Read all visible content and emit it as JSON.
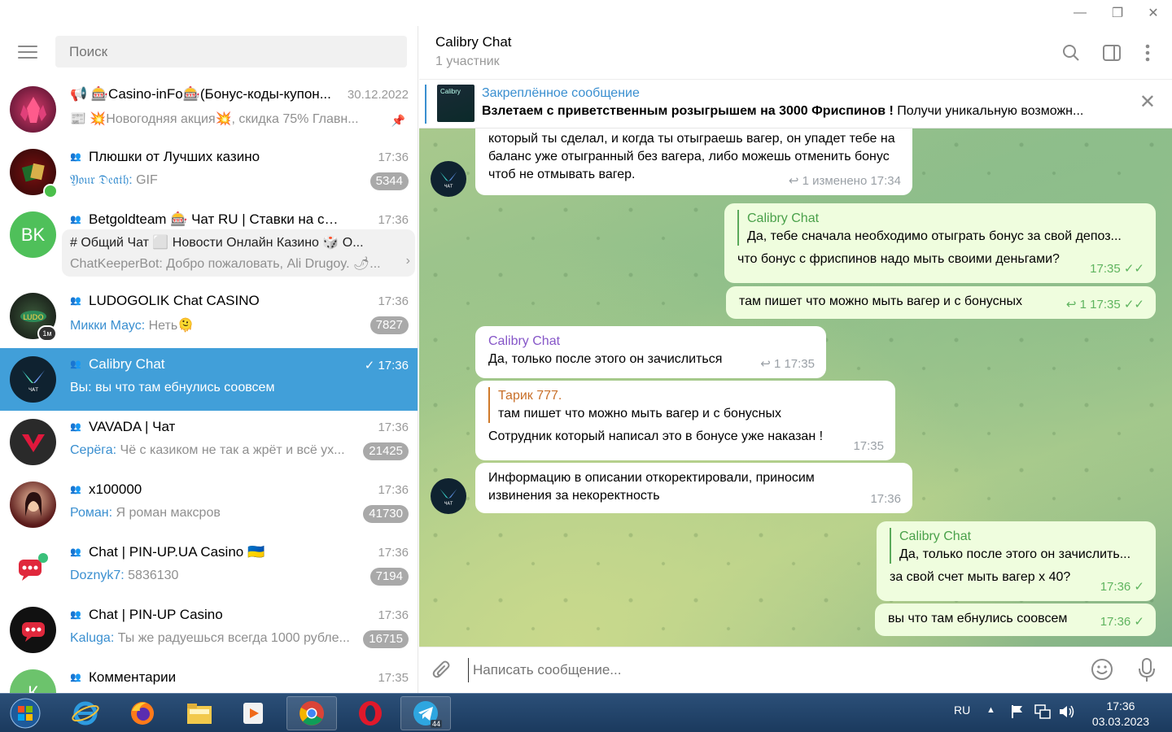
{
  "window": {
    "minimize": "—",
    "restore": "❐",
    "close": "✕"
  },
  "search": {
    "placeholder": "Поиск"
  },
  "chats": [
    {
      "title": "📢 🎰Casino-inFo🎰(Бонус-коды-купон...",
      "time": "30.12.2022",
      "preview": "📰 💥Новогодняя акция💥, скидка 75% Главн...",
      "pinned": true
    },
    {
      "title": "Плюшки от Лучших казино",
      "time": "17:36",
      "sender": "𝔜𝔬𝔲𝔯 𝔇𝔢𝔞𝔱𝔥:",
      "preview": " GIF",
      "badge": "5344"
    },
    {
      "title": "Betgoldteam 🎰 Чат RU | Ставки на спор...",
      "time": "17:36",
      "avatar_text": "BK",
      "topics": "# Общий Чат   ⬜ Новости Онлайн Казино   🎲 О...",
      "topic_sender": "ChatKeeperBot:",
      "topic_preview": " Добро пожаловать, Ali Drugoy. 🌶..."
    },
    {
      "title": "LUDOGOLIK Chat CASINO",
      "time": "17:36",
      "sender": "Микки Маус:",
      "preview": " Неть🫠",
      "badge": "7827"
    },
    {
      "title": "Calibry Chat",
      "time": "✓ 17:36",
      "preview": "Вы: вы что там ебнулись соовсем"
    },
    {
      "title": "VAVADA | Чат",
      "time": "17:36",
      "sender": "Серёга:",
      "preview": " Чё с казиком не так а жрёт и всё ух...",
      "badge": "21425"
    },
    {
      "title": "x100000",
      "time": "17:36",
      "sender": "Роман:",
      "preview": " Я роман максров",
      "badge": "41730"
    },
    {
      "title": "Chat | PIN-UP.UA Casino 🇺🇦",
      "time": "17:36",
      "sender": "Doznyk7:",
      "preview": " 5836130",
      "badge": "7194"
    },
    {
      "title": "Chat | PIN-UP Casino",
      "time": "17:36",
      "sender": "Kaluga:",
      "preview": " Ты же радуешься всегда 1000 рубле...",
      "badge": "16715"
    },
    {
      "title": "Комментарии",
      "time": "17:35",
      "avatar_text": "К"
    }
  ],
  "header": {
    "title": "Calibry Chat",
    "subtitle": "1 участник"
  },
  "pinned": {
    "label": "Закреплённое сообщение",
    "bold": "Взлетаем с приветственным розыгрышем на 3000 Фриспинов !",
    "text": " Получи уникальную возможн...",
    "thumb_text": "Calibry"
  },
  "messages": {
    "m1": {
      "text": "Да, тебе сначала необходимо отыграть бонус за свой депозит который ты сделал, и когда ты отыграешь вагер, он упадет тебе на баланс уже отыгранный без вагера, либо можешь отменить бонус чтоб не отмывать вагер.",
      "meta": "↩ 1   изменено 17:34"
    },
    "m2": {
      "reply_name": "Calibry Chat",
      "reply_text": "Да, тебе сначала необходимо отыграть бонус за свой депоз...",
      "text": "что бонус с фриспинов надо мыть своими деньгами?",
      "meta": "17:35 ✓✓"
    },
    "m3": {
      "text": "там пишет что можно мыть вагер и с бонусных",
      "meta": "↩ 1  17:35 ✓✓"
    },
    "m4": {
      "sender": "Calibry Chat",
      "text": "Да, только после этого он зачислиться",
      "meta": "↩ 1  17:35"
    },
    "m5": {
      "reply_name": "Тарик 777.",
      "reply_text": "там пишет что можно мыть вагер и с бонусных",
      "text": "Сотрудник который написал это в бонусе уже наказан !",
      "meta": "17:35"
    },
    "m6": {
      "text": "Информацию в описании откоректировали, приносим извинения за некоректность",
      "meta": "17:36"
    },
    "m7": {
      "reply_name": "Calibry Chat",
      "reply_text": "Да, только после этого он зачислить...",
      "text": "за свой счет мыть вагер х 40?",
      "meta": "17:36 ✓"
    },
    "m8": {
      "text": "вы что там ебнулись соовсем",
      "meta": "17:36 ✓"
    }
  },
  "composer": {
    "placeholder": "Написать сообщение..."
  },
  "taskbar": {
    "lang": "RU",
    "time": "17:36",
    "date": "03.03.2023",
    "telegram_badge": "44"
  },
  "colors": {
    "accent": "#419fd9",
    "out_bubble": "#effdde",
    "unread_badge": "#a9a9a9"
  }
}
